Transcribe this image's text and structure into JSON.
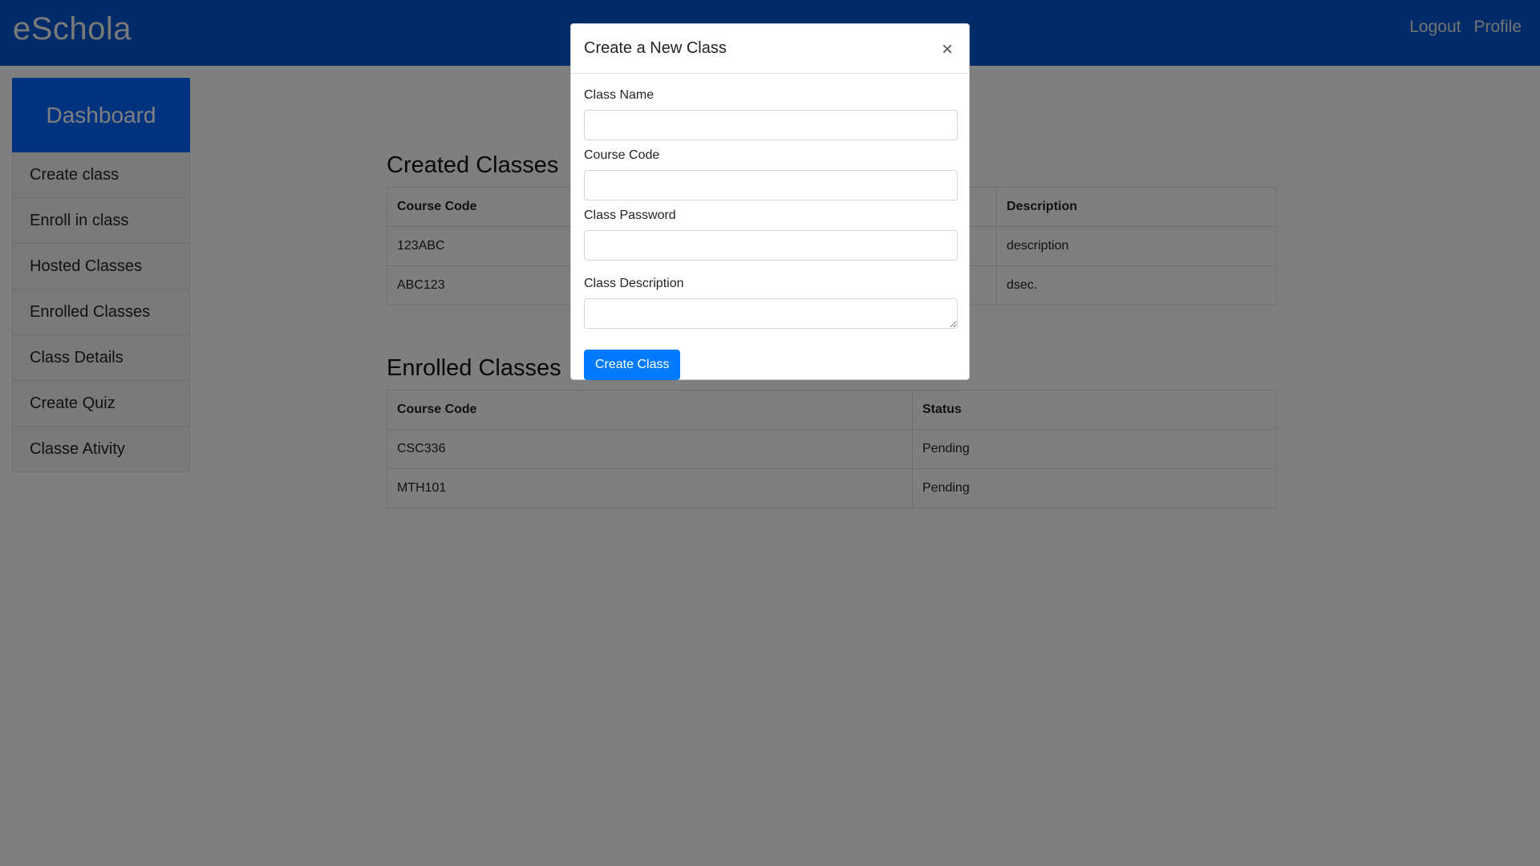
{
  "navbar": {
    "brand": "eSchola",
    "links": [
      "Logout",
      "Profile"
    ]
  },
  "sidebar": {
    "title": "Dashboard",
    "items": [
      {
        "label": "Create class"
      },
      {
        "label": "Enroll in class"
      },
      {
        "label": "Hosted Classes"
      },
      {
        "label": "Enrolled Classes"
      },
      {
        "label": "Class Details"
      },
      {
        "label": "Create Quiz"
      },
      {
        "label": "Classe Ativity"
      }
    ]
  },
  "created_classes": {
    "title": "Created Classes",
    "headers": [
      "Course Code",
      "Description"
    ],
    "rows": [
      [
        "123ABC",
        "description"
      ],
      [
        "ABC123",
        "dsec."
      ]
    ]
  },
  "enrolled_classes": {
    "title": "Enrolled Classes",
    "headers": [
      "Course Code",
      "Status"
    ],
    "rows": [
      [
        "CSC336",
        "Pending"
      ],
      [
        "MTH101",
        "Pending"
      ]
    ]
  },
  "modal": {
    "title": "Create a New Class",
    "close_glyph": "×",
    "fields": {
      "class_name": {
        "label": "Class Name",
        "value": ""
      },
      "course_code": {
        "label": "Course Code",
        "value": ""
      },
      "class_password": {
        "label": "Class Password",
        "value": ""
      },
      "class_description": {
        "label": "Class Description",
        "value": ""
      }
    },
    "submit_label": "Create Class"
  }
}
